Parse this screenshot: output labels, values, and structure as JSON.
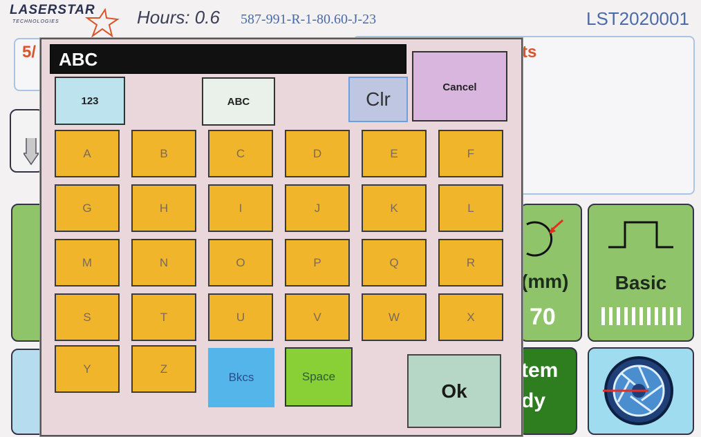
{
  "header": {
    "logo_text": "LASERSTAR",
    "logo_subtext": "TECHNOLOGIES",
    "hours_text": "Hours: 0.6",
    "serial_code": "587-991-R-1-80.60-J-23",
    "device_id": "LST2020001"
  },
  "background": {
    "left_panel_title": "5/",
    "right_panel_title": "ts",
    "spot_label": "(mm)",
    "spot_value": "70",
    "shape_label": "Basic",
    "system_label_1": "tem",
    "system_label_2": "dy"
  },
  "keypad": {
    "entry_value": "ABC",
    "mode_123": "123",
    "mode_abc": "ABC",
    "clear_label": "Clr",
    "cancel_label": "Cancel",
    "keys": [
      "A",
      "B",
      "C",
      "D",
      "E",
      "F",
      "G",
      "H",
      "I",
      "J",
      "K",
      "L",
      "M",
      "N",
      "O",
      "P",
      "Q",
      "R",
      "S",
      "T",
      "U",
      "V",
      "W",
      "X",
      "Y",
      "Z"
    ],
    "backspace_label": "Bkcs",
    "space_label": "Space",
    "ok_label": "Ok"
  },
  "colors": {
    "key_fill": "#f0b52a",
    "accent_orange": "#d9542a",
    "accent_blue": "#4a6aa8",
    "green_button": "#8fc46a",
    "dark_green_button": "#2e7d1e"
  },
  "icons": [
    "laserstar-star-logo",
    "pulse-shape-icon",
    "spot-circle-icon",
    "camera-aperture-icon",
    "arrow-down-icon"
  ]
}
